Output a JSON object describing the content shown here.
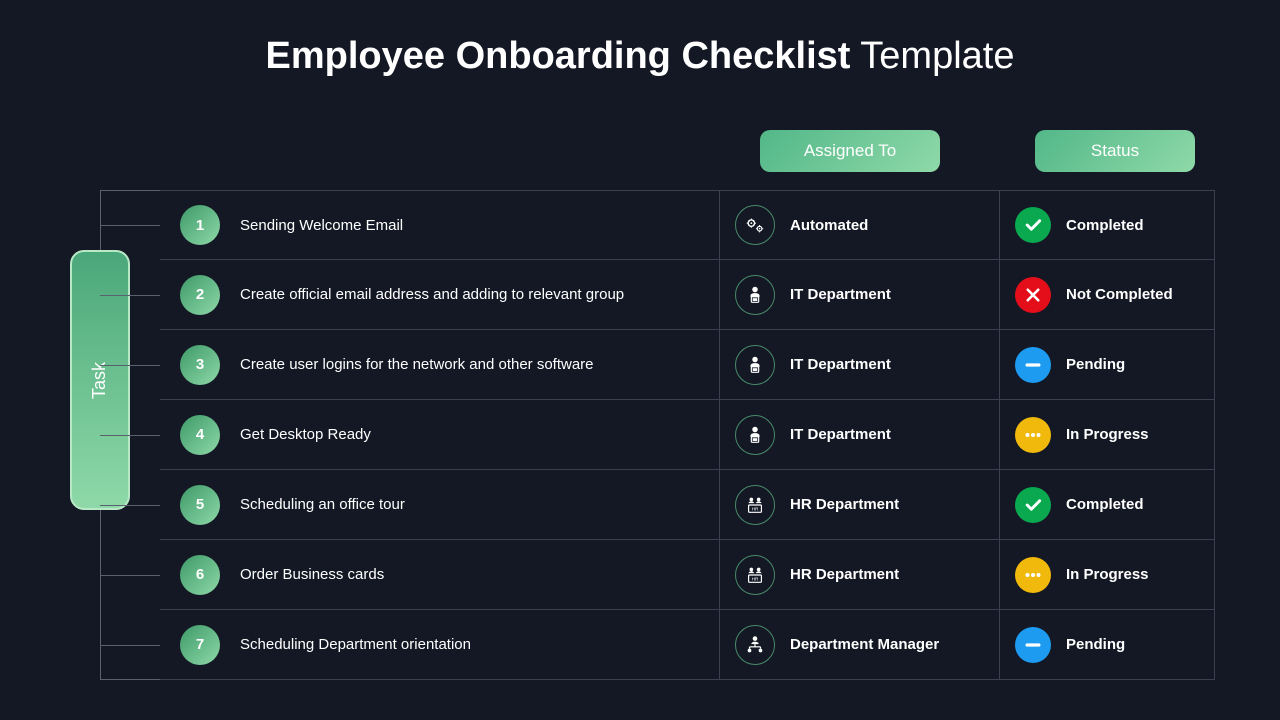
{
  "title_bold": "Employee Onboarding Checklist",
  "title_light": " Template",
  "headers": {
    "assigned": "Assigned To",
    "status": "Status"
  },
  "task_label": "Task",
  "rows": [
    {
      "num": "1",
      "task": "Sending Welcome Email",
      "assigned": "Automated",
      "assigned_icon": "gears",
      "status": "Completed",
      "status_type": "completed"
    },
    {
      "num": "2",
      "task": "Create official email address and adding to relevant group",
      "assigned": "IT Department",
      "assigned_icon": "it",
      "status": "Not Completed",
      "status_type": "notcompleted"
    },
    {
      "num": "3",
      "task": "Create user logins for the network and other software",
      "assigned": "IT Department",
      "assigned_icon": "it",
      "status": "Pending",
      "status_type": "pending"
    },
    {
      "num": "4",
      "task": "Get Desktop Ready",
      "assigned": "IT Department",
      "assigned_icon": "it",
      "status": "In Progress",
      "status_type": "inprogress"
    },
    {
      "num": "5",
      "task": "Scheduling an office tour",
      "assigned": "HR Department",
      "assigned_icon": "hr",
      "status": "Completed",
      "status_type": "completed"
    },
    {
      "num": "6",
      "task": "Order Business cards",
      "assigned": "HR Department",
      "assigned_icon": "hr",
      "status": "In Progress",
      "status_type": "inprogress"
    },
    {
      "num": "7",
      "task": "Scheduling Department orientation",
      "assigned": "Department Manager",
      "assigned_icon": "manager",
      "status": "Pending",
      "status_type": "pending"
    }
  ]
}
